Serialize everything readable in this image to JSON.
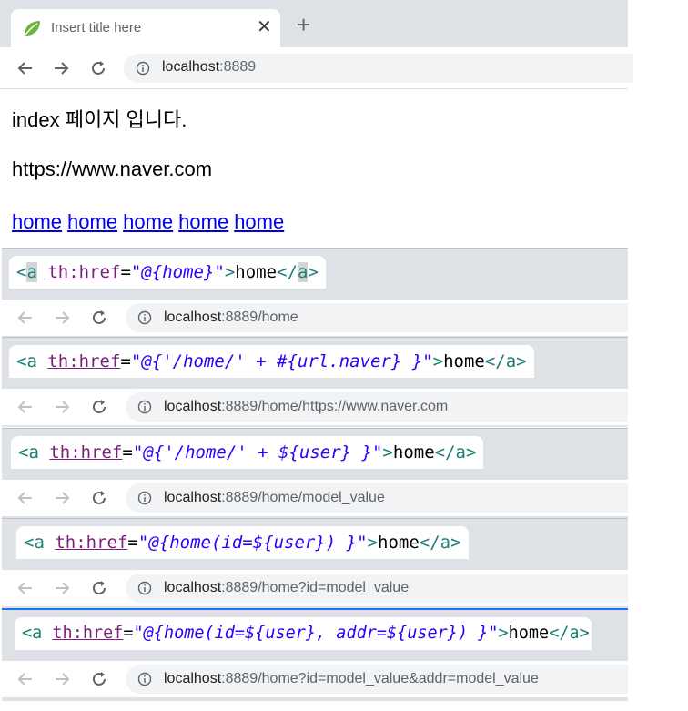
{
  "tab": {
    "title": "Insert title here",
    "close": "✕",
    "new_tab": "+"
  },
  "toolbar": {
    "url_host": "localhost",
    "url_rest": ":8889"
  },
  "page": {
    "line1": "index 페이지 입니다.",
    "line2": "https://www.naver.com",
    "links": [
      "home",
      "home",
      "home",
      "home",
      "home"
    ]
  },
  "panels": [
    {
      "code": {
        "open": "<",
        "tag": "a",
        "attr": "th:href",
        "eq": "=",
        "value": "\"@{home}\"",
        "close_open": ">",
        "text": "home",
        "end_open": "</",
        "end_tag": "a",
        "end_close": ">"
      },
      "url_host": "localhost",
      "url_rest": ":8889/home"
    },
    {
      "code": {
        "open": "<a",
        "attr": "th:href",
        "eq": "=",
        "value": "\"@{'/home/' + #{url.naver} }\"",
        "close_open": ">",
        "text": "home",
        "end": "</a>"
      },
      "url_host": "localhost",
      "url_rest": ":8889/home/https://www.naver.com"
    },
    {
      "code": {
        "open": "<a",
        "attr": "th:href",
        "eq": "=",
        "value": "\"@{'/home/' + ${user} }\"",
        "close_open": ">",
        "text": "home",
        "end": "</a>"
      },
      "url_host": "localhost",
      "url_rest": ":8889/home/model_value"
    },
    {
      "code": {
        "open": "<a",
        "attr": "th:href",
        "eq": "=",
        "value": "\"@{home(id=${user}) }\"",
        "close_open": ">",
        "text": "home",
        "end": "</a>"
      },
      "url_host": "localhost",
      "url_rest": ":8889/home?id=model_value"
    },
    {
      "code": {
        "open": "<a",
        "attr": "th:href",
        "eq": "=",
        "value": "\"@{home(id=${user}, addr=${user}) }\"",
        "close_open": ">",
        "text": "home",
        "end": "</a>"
      },
      "url_host": "localhost",
      "url_rest": ":8889/home?id=model_value&addr=model_value"
    }
  ],
  "icons": {
    "favicon": "spring-leaf-icon",
    "back": "arrow-left-icon",
    "forward": "arrow-right-icon",
    "reload": "reload-icon",
    "info": "info-icon"
  },
  "colors": {
    "tabstrip": "#dee1e6",
    "link": "#0000ee",
    "tag": "#1a7f74",
    "attr": "#7a1f7a",
    "string": "#2a00ff",
    "favicon": "#6db33f"
  }
}
